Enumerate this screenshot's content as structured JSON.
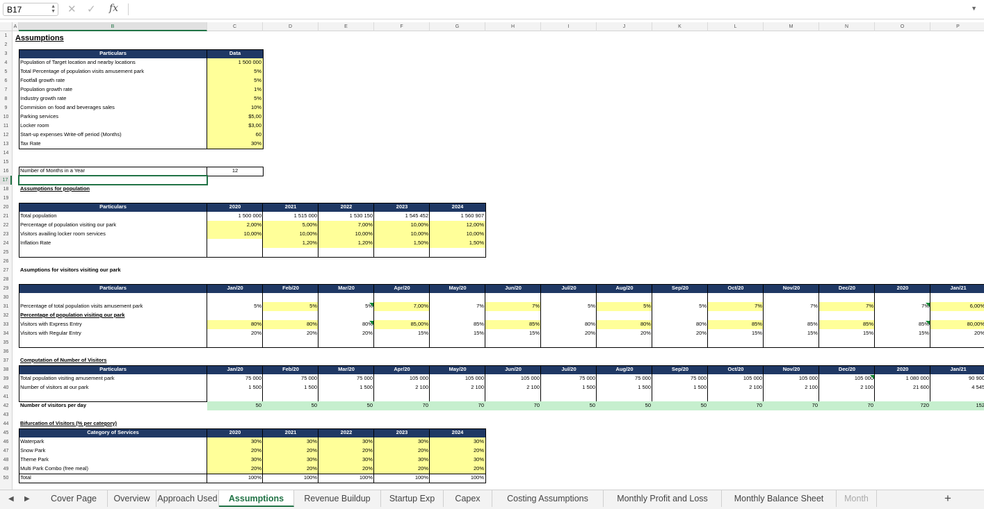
{
  "formula_bar": {
    "cell_ref": "B17",
    "fx": "fx",
    "cancel": "✕",
    "confirm": "✓",
    "content": ""
  },
  "columns": [
    "A",
    "B",
    "C",
    "D",
    "E",
    "F",
    "G",
    "H",
    "I",
    "J",
    "K",
    "L",
    "M",
    "N",
    "O",
    "P"
  ],
  "selected_column": "B",
  "selected_row": 17,
  "rows": [
    1,
    2,
    3,
    4,
    5,
    6,
    7,
    8,
    9,
    10,
    11,
    12,
    13,
    14,
    15,
    16,
    17,
    18,
    19,
    20,
    21,
    22,
    23,
    24,
    25,
    26,
    27,
    28,
    29,
    30,
    31,
    32,
    33,
    34,
    35,
    36,
    37,
    38,
    39,
    40,
    41,
    42,
    43,
    44,
    45,
    46,
    47,
    48,
    49,
    50
  ],
  "title": "Assumptions",
  "assumptions": {
    "header": [
      "Particulars",
      "Data"
    ],
    "rows": [
      [
        "Population of Target location and nearby locations",
        "1 500 000"
      ],
      [
        "Total Percentage of population visits amusement park",
        "5%"
      ],
      [
        "Footfall growth rate",
        "5%"
      ],
      [
        "Population growth rate",
        "1%"
      ],
      [
        "Industry growth rate",
        "5%"
      ],
      [
        "Commision on food and beverages sales",
        "10%"
      ],
      [
        "Parking services",
        "$5,00"
      ],
      [
        "Locker room",
        "$3,00"
      ],
      [
        "Start-up expenses Write-off period (Months)",
        "60"
      ],
      [
        "Tax Rate",
        "30%"
      ]
    ]
  },
  "months_in_year": {
    "label": "Number of Months in a Year",
    "value": "12"
  },
  "population": {
    "title": "Assumptions for population",
    "header": [
      "Particulars",
      "2020",
      "2021",
      "2022",
      "2023",
      "2024"
    ],
    "rows": [
      [
        "Total population",
        "1 500 000",
        "1 515 000",
        "1 530 150",
        "1 545 452",
        "1 560 907"
      ],
      [
        "Percentage of population visiting our park",
        "2,00%",
        "5,00%",
        "7,00%",
        "10,00%",
        "12,00%"
      ],
      [
        "Visitors availing locker room services",
        "10,00%",
        "10,00%",
        "10,00%",
        "10,00%",
        "10,00%"
      ],
      [
        "Inflation Rate",
        "",
        "1,20%",
        "1,20%",
        "1,50%",
        "1,50%"
      ]
    ]
  },
  "visitors": {
    "title": "Asumptions for visitors visiting our park",
    "header": [
      "Particulars",
      "Jan/20",
      "Feb/20",
      "Mar/20",
      "Apr/20",
      "May/20",
      "Jun/20",
      "Jul/20",
      "Aug/20",
      "Sep/20",
      "Oct/20",
      "Nov/20",
      "Dec/20",
      "2020",
      "Jan/21"
    ],
    "rows": [
      [
        "Percentage of total population visits amusement park",
        "5%",
        "5%",
        "5%",
        "7,00%",
        "7%",
        "7%",
        "5%",
        "5%",
        "5%",
        "7%",
        "7%",
        "7%",
        "7%",
        "6,00%"
      ],
      [
        "Percentage of population visiting our park",
        "",
        "",
        "",
        "",
        "",
        "",
        "",
        "",
        "",
        "",
        "",
        "",
        "",
        ""
      ],
      [
        "Visitors with Express Entry",
        "80%",
        "80%",
        "80%",
        "85,00%",
        "85%",
        "85%",
        "80%",
        "80%",
        "80%",
        "85%",
        "85%",
        "85%",
        "85%",
        "80,00%"
      ],
      [
        "Visitors with Regular Entry",
        "20%",
        "20%",
        "20%",
        "15%",
        "15%",
        "15%",
        "20%",
        "20%",
        "20%",
        "15%",
        "15%",
        "15%",
        "15%",
        "20%"
      ]
    ]
  },
  "computation": {
    "title": "Computation of Number of Visitors",
    "header": [
      "Particulars",
      "Jan/20",
      "Feb/20",
      "Mar/20",
      "Apr/20",
      "May/20",
      "Jun/20",
      "Jul/20",
      "Aug/20",
      "Sep/20",
      "Oct/20",
      "Nov/20",
      "Dec/20",
      "2020",
      "Jan/21"
    ],
    "rows": [
      [
        "Total population visiting amusement park",
        "75 000",
        "75 000",
        "75 000",
        "105 000",
        "105 000",
        "105 000",
        "75 000",
        "75 000",
        "75 000",
        "105 000",
        "105 000",
        "105 000",
        "1 080 000",
        "90 900"
      ],
      [
        "Number of visitors at our park",
        "1 500",
        "1 500",
        "1 500",
        "2 100",
        "2 100",
        "2 100",
        "1 500",
        "1 500",
        "1 500",
        "2 100",
        "2 100",
        "2 100",
        "21 600",
        "4 545"
      ]
    ],
    "per_day": [
      "Number of visitors per day",
      "50",
      "50",
      "50",
      "70",
      "70",
      "70",
      "50",
      "50",
      "50",
      "70",
      "70",
      "70",
      "720",
      "152"
    ]
  },
  "bifurcation": {
    "title": "Bifurcation of Visitors (% per category)",
    "header": [
      "Category of Services",
      "2020",
      "2021",
      "2022",
      "2023",
      "2024"
    ],
    "rows": [
      [
        "Waterpark",
        "30%",
        "30%",
        "30%",
        "30%",
        "30%"
      ],
      [
        "Snow Park",
        "20%",
        "20%",
        "20%",
        "20%",
        "20%"
      ],
      [
        "Theme Park",
        "30%",
        "30%",
        "30%",
        "30%",
        "30%"
      ],
      [
        "Multi Park Combo (free meal)",
        "20%",
        "20%",
        "20%",
        "20%",
        "20%"
      ],
      [
        "Total",
        "100%",
        "100%",
        "100%",
        "100%",
        "100%"
      ]
    ]
  },
  "tabs": [
    "Cover Page",
    "Overview",
    "Approach Used",
    "Assumptions",
    "Revenue Buildup",
    "Startup Exp",
    "Capex",
    "Costing Assumptions",
    "Monthly Profit and Loss",
    "Monthly Balance Sheet",
    "Month"
  ],
  "active_tab": "Assumptions",
  "tab_add": "+",
  "colors": {
    "header_fill": "#1f3864",
    "input_fill": "#ffff99",
    "highlight_fill": "#c6efce",
    "accent": "#217346"
  }
}
